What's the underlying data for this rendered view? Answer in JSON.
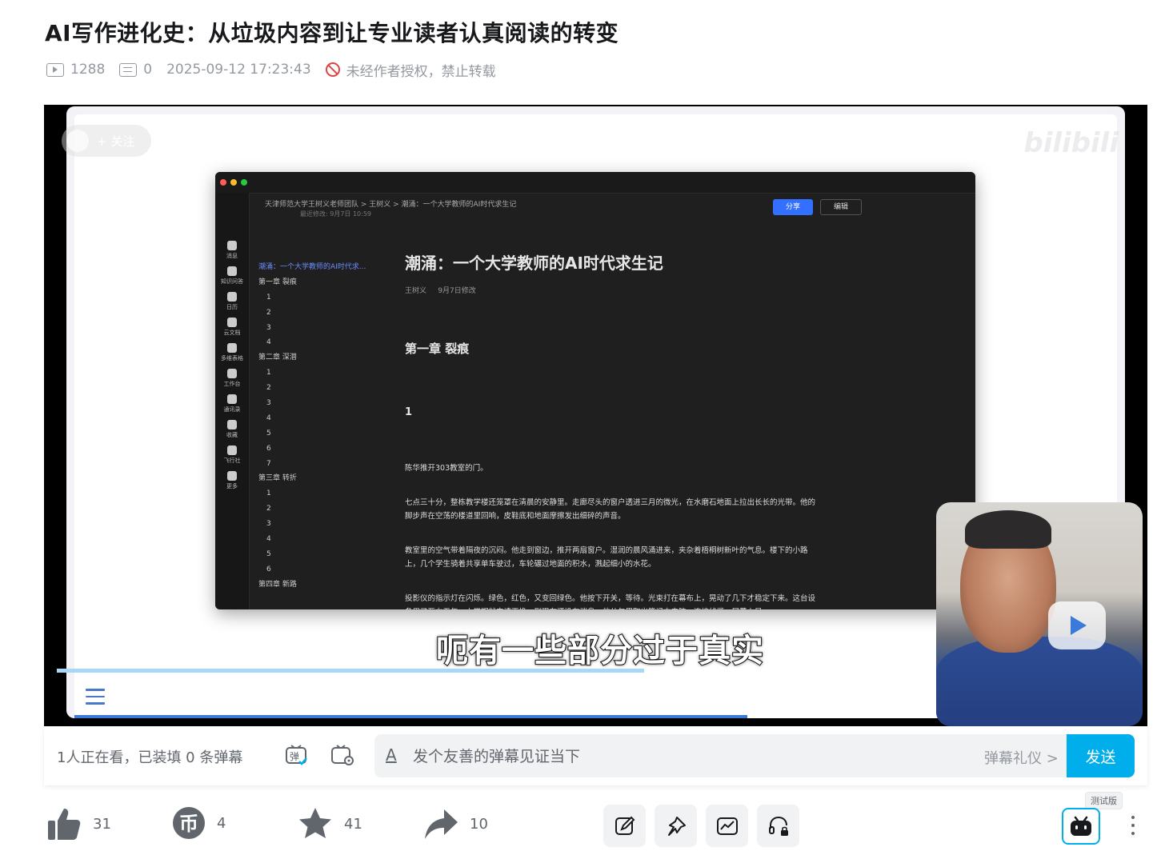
{
  "video": {
    "title": "AI写作进化史：从垃圾内容到让专业读者认真阅读的转变",
    "play_count": "1288",
    "danmaku_count": "0",
    "publish_time": "2025-09-12 17:23:43",
    "copyright": "未经作者授权，禁止转载"
  },
  "player": {
    "follow_label": "+ 关注",
    "subtitle": "呃有一些部分过于真实",
    "progress_fraction": 0.58,
    "screen_app": {
      "breadcrumb": "天津师范大学王树义老师团队 > 王树义 > 潮涌：一个大学教师的AI时代求生记",
      "last_modified": "最近修改: 9月7日 10:59",
      "share_label": "分享",
      "edit_label": "编辑",
      "toc": [
        {
          "label": "潮涌：一个大学教师的AI时代求...",
          "selected": true,
          "indent": false
        },
        {
          "label": "第一章 裂痕",
          "indent": false
        },
        {
          "label": "1",
          "indent": true
        },
        {
          "label": "2",
          "indent": true
        },
        {
          "label": "3",
          "indent": true
        },
        {
          "label": "4",
          "indent": true
        },
        {
          "label": "第二章 深潜",
          "indent": false
        },
        {
          "label": "1",
          "indent": true
        },
        {
          "label": "2",
          "indent": true
        },
        {
          "label": "3",
          "indent": true
        },
        {
          "label": "4",
          "indent": true
        },
        {
          "label": "5",
          "indent": true
        },
        {
          "label": "6",
          "indent": true
        },
        {
          "label": "7",
          "indent": true
        },
        {
          "label": "第三章 转折",
          "indent": false
        },
        {
          "label": "1",
          "indent": true
        },
        {
          "label": "2",
          "indent": true
        },
        {
          "label": "3",
          "indent": true
        },
        {
          "label": "4",
          "indent": true
        },
        {
          "label": "5",
          "indent": true
        },
        {
          "label": "6",
          "indent": true
        },
        {
          "label": "第四章 新路",
          "indent": false
        }
      ],
      "doc_title": "潮涌：一个大学教师的AI时代求生记",
      "doc_author": "王树义",
      "doc_modified": "9月7日修改",
      "chapter": "第一章 裂痕",
      "section": "1",
      "paragraphs": [
        "陈华推开303教室的门。",
        "七点三十分，整栋教学楼还笼罩在清晨的安静里。走廊尽头的窗户透进三月的微光，在水磨石地面上拉出长长的光带。他的脚步声在空荡的楼道里回响，皮鞋底和地面摩擦发出细碎的声音。",
        "教室里的空气带着隔夜的沉闷。他走到窗边，推开两扇窗户。湿润的晨风涌进来，夹杂着梧桐树新叶的气息。楼下的小路上，几个学生骑着共享单车驶过，车轮碾过地面的积水，溅起细小的水花。",
        "投影仪的指示灯在闪烁。绿色，红色，又变回绿色。他按下开关，等待。光束打在幕布上，晃动了几下才稳定下来。这台设备用了至少五年，上学期就申请更换，到现在还没有消息。他从包里取出笔记本电脑，连接线缆，屏幕上显"
      ],
      "rail_items": [
        "消息",
        "知识问答",
        "日历",
        "云文档",
        "多维表格",
        "工作台",
        "通讯录",
        "收藏",
        "飞行社",
        "更多"
      ]
    }
  },
  "danmaku": {
    "watching_text": "1人正在看，已装填 0 条弹幕",
    "placeholder": "发个友善的弹幕见证当下",
    "etiquette": "弹幕礼仪 >",
    "send_label": "发送"
  },
  "actions": {
    "like": "31",
    "coin": "4",
    "favorite": "41",
    "share": "10"
  },
  "beta_label": "测试版"
}
